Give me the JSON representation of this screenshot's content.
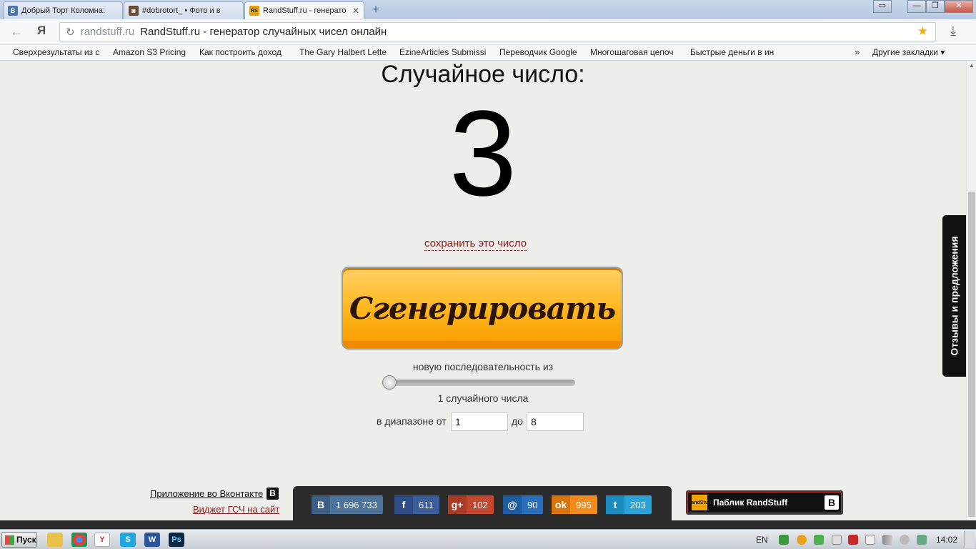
{
  "browser": {
    "tabs": [
      {
        "label": "Добрый Торт Коломна:",
        "favicon": "vk-icon",
        "color": "#4a76a8",
        "glyph": "В"
      },
      {
        "label": "#dobrotort_ • Фото и в",
        "favicon": "instagram-icon",
        "color": "#6b4a32",
        "glyph": "◙"
      },
      {
        "label": "RandStuff.ru - генерато",
        "favicon": "randstuff-icon",
        "color": "#e8a100",
        "glyph": "RS"
      }
    ],
    "new_tab": "+",
    "window_controls": {
      "tabs_list": "▭",
      "minimize": "—",
      "maximize": "❐",
      "close": "✕"
    },
    "yandex_logo": "Я",
    "address": {
      "host": "randstuff.ru",
      "title": "RandStuff.ru - генератор случайных чисел онлайн"
    },
    "bookmarks": [
      "Сверхрезультаты из с",
      "Amazon S3 Pricing",
      "Как построить доход",
      "The Gary Halbert Lette",
      "EzineArticles Submissi",
      "Переводчик Google",
      "Многошаговая цепоч",
      "Быстрые деньги в ин"
    ],
    "bookmarks_more": "»",
    "other_bookmarks": "Другие закладки ▾"
  },
  "page": {
    "heading": "Случайное число:",
    "number": "3",
    "save_link": "сохранить это число",
    "generate_button": "Сгенерировать",
    "sequence_label": "новую последовательность из",
    "slider_value": 1,
    "count_label": "1 случайного числа",
    "range_from_label": "в диапазоне от",
    "range_from": "1",
    "range_to_label": "до",
    "range_to": "8",
    "side_tab": "Отзывы и предложения",
    "vk_app_link": "Приложение во Вконтакте",
    "vk_badge": "В",
    "widget_link": "Виджет ГСЧ на сайт",
    "shares": [
      {
        "icon": "vk-icon",
        "glyph": "В",
        "count": "1 696 733",
        "color": "#4d739a"
      },
      {
        "icon": "facebook-icon",
        "glyph": "f",
        "count": "611",
        "color": "#3b5b99"
      },
      {
        "icon": "googleplus-icon",
        "glyph": "g+",
        "count": "102",
        "color": "#c5472e"
      },
      {
        "icon": "mailru-icon",
        "glyph": "@",
        "count": "90",
        "color": "#2a6fbd"
      },
      {
        "icon": "odnoklassniki-icon",
        "glyph": "ok",
        "count": "995",
        "color": "#f28a1c"
      },
      {
        "icon": "twitter-icon",
        "glyph": "t",
        "count": "203",
        "color": "#2aa3d9"
      }
    ],
    "public_label": "Паблик RandStuff",
    "public_logo": "RandStuff",
    "public_badge": "В"
  },
  "taskbar": {
    "start": "Пуск",
    "language": "EN",
    "clock": "14:02"
  }
}
